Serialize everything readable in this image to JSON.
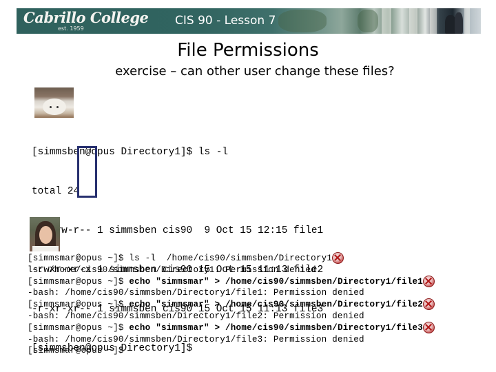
{
  "header": {
    "logo_text": "Cabrillo College",
    "logo_subtext": "est. 1959",
    "title": "CIS 90 - Lesson 7"
  },
  "slide": {
    "heading": "File Permissions",
    "subheading": "exercise – can other user change these files?"
  },
  "owner_session": {
    "photo": "dog-photo",
    "lines": [
      "[simmsben@opus Directory1]$ ls -l",
      "total 24",
      "-rw-rw-r-- 1 simmsben cis90  9 Oct 15 12:15 file1",
      "-rwxr-xr-x 1 simmsben cis90 15 Oct 15 11:13 file2",
      "-r-xr-xr-- 1 simmsben cis90 15 Oct 15 11:13 file3",
      "[simmsben@opus Directory1]$"
    ],
    "highlight": "other-permissions-column",
    "highlight_color": "#27306f"
  },
  "other_user_session": {
    "photo": "woman-photo",
    "lines": [
      {
        "prompt": "[simmsmar@opus ~]$ ",
        "cmd": "ls -l  /home/cis90/simmsben/Directory1",
        "bold": false,
        "denied_icon": true
      },
      {
        "text": "ls: /home/cis90/simmsben/Directory1: Permission denied"
      },
      {
        "prompt": "[simmsmar@opus ~]$ ",
        "cmd": "echo \"simmsmar\" > /home/cis90/simmsben/Directory1/file1",
        "bold": true,
        "denied_icon": true
      },
      {
        "text": "-bash: /home/cis90/simmsben/Directory1/file1: Permission denied"
      },
      {
        "prompt": "[simmsmar@opus ~]$ ",
        "cmd": "echo \"simmsmar\" > /home/cis90/simmsben/Directory1/file2",
        "bold": true,
        "denied_icon": true
      },
      {
        "text": "-bash: /home/cis90/simmsben/Directory1/file2: Permission denied"
      },
      {
        "prompt": "[simmsmar@opus ~]$ ",
        "cmd": "echo \"simmsmar\" > /home/cis90/simmsben/Directory1/file3",
        "bold": true,
        "denied_icon": true
      },
      {
        "text": "-bash: /home/cis90/simmsben/Directory1/file3: Permission denied"
      },
      {
        "prompt": "[simmsmar@opus ~]$",
        "cmd": "",
        "bold": false,
        "denied_icon": false
      }
    ],
    "denied_icon_name": "denied-x-icon",
    "denied_icon_color": "#b01515"
  }
}
